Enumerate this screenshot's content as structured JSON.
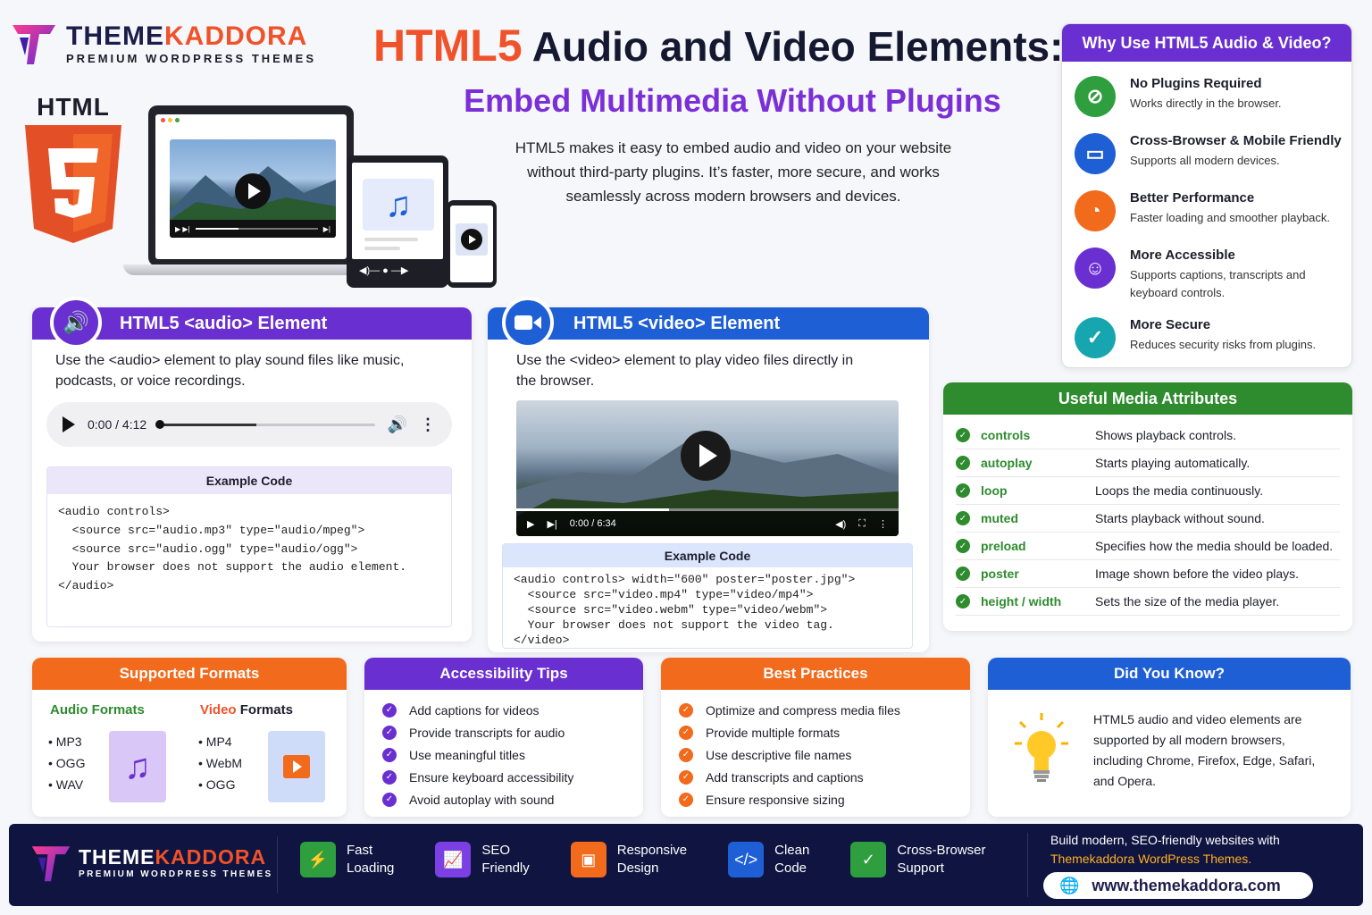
{
  "brand": {
    "name_part1": "THEME",
    "name_part2": "KADDORA",
    "subtitle": "PREMIUM WORDPRESS THEMES"
  },
  "html5_logo": {
    "label": "HTML",
    "number": "5"
  },
  "hero": {
    "title_accent": "HTML5",
    "title_rest": "Audio and Video Elements:",
    "subtitle": "Embed Multimedia Without Plugins",
    "description": "HTML5 makes it easy to embed audio and video on your website without third-party plugins. It’s faster, more secure, and works seamlessly across modern browsers and devices."
  },
  "why": {
    "title": "Why Use HTML5 Audio & Video?",
    "items": [
      {
        "title": "No Plugins Required",
        "desc": "Works directly in the browser.",
        "icon": "no-plugin-icon",
        "color": "#2e9e3e"
      },
      {
        "title": "Cross-Browser & Mobile Friendly",
        "desc": "Supports all modern devices.",
        "icon": "devices-icon",
        "color": "#1e5fd6"
      },
      {
        "title": "Better Performance",
        "desc": "Faster loading and smoother playback.",
        "icon": "speedometer-icon",
        "color": "#f26a1b"
      },
      {
        "title": "More Accessible",
        "desc": "Supports captions, transcripts and keyboard controls.",
        "icon": "accessibility-icon",
        "color": "#6a2fd0"
      },
      {
        "title": "More Secure",
        "desc": "Reduces security risks from plugins.",
        "icon": "shield-check-icon",
        "color": "#17a6b0"
      }
    ]
  },
  "audio": {
    "title": "HTML5 <audio> Element",
    "desc": "Use the <audio> element to play sound files like music, podcasts, or voice recordings.",
    "player_time": "0:00 / 4:12",
    "progress": 0.45,
    "code_title": "Example Code",
    "code": [
      "<audio controls>",
      "  <source src=\"audio.mp3\" type=\"audio/mpeg\">",
      "  <source src=\"audio.ogg\" type=\"audio/ogg\">",
      "  Your browser does not support the audio element.",
      "</audio>"
    ]
  },
  "video": {
    "title": "HTML5 <video> Element",
    "desc": "Use the <video> element to play video files directly in the browser.",
    "player_time": "0:00 / 6:34",
    "progress": 0.4,
    "code_title": "Example Code",
    "code": [
      "<audio controls> width=\"600\" poster=\"poster.jpg\">",
      "  <source src=\"video.mp4\" type=\"video/mp4\">",
      "  <source src=\"video.webm\" type=\"video/webm\">",
      "  Your browser does not support the video tag.",
      "</video>"
    ]
  },
  "attributes": {
    "title": "Useful Media Attributes",
    "rows": [
      {
        "name": "controls",
        "desc": "Shows playback controls."
      },
      {
        "name": "autoplay",
        "desc": "Starts playing automatically."
      },
      {
        "name": "loop",
        "desc": "Loops the media continuously."
      },
      {
        "name": "muted",
        "desc": "Starts playback without sound."
      },
      {
        "name": "preload",
        "desc": "Specifies how the media should be loaded."
      },
      {
        "name": "poster",
        "desc": "Image shown before the video plays."
      },
      {
        "name": "height / width",
        "desc": "Sets the size of the media player."
      }
    ]
  },
  "formats": {
    "title": "Supported Formats",
    "audio_title": "Audio Formats",
    "audio": [
      "MP3",
      "OGG",
      "WAV"
    ],
    "video_title_accent": "Video",
    "video_title_rest": "Formats",
    "video": [
      "MP4",
      "WebM",
      "OGG"
    ]
  },
  "accessibility": {
    "title": "Accessibility Tips",
    "items": [
      "Add captions for videos",
      "Provide transcripts for audio",
      "Use meaningful titles",
      "Ensure keyboard accessibility",
      "Avoid autoplay with sound"
    ]
  },
  "practices": {
    "title": "Best Practices",
    "items": [
      "Optimize and compress media files",
      "Provide multiple formats",
      "Use descriptive file names",
      "Add transcripts and captions",
      "Ensure responsive sizing"
    ]
  },
  "didyouknow": {
    "title": "Did You Know?",
    "text": "HTML5 audio and video elements are supported by all modern browsers, including Chrome, Firefox, Edge, Safari, and Opera."
  },
  "footer": {
    "features": [
      {
        "line1": "Fast",
        "line2": "Loading",
        "icon": "lightning-icon",
        "color": "#2e9e3e"
      },
      {
        "line1": "SEO",
        "line2": "Friendly",
        "icon": "chart-icon",
        "color": "#7b3fe4"
      },
      {
        "line1": "Responsive",
        "line2": "Design",
        "icon": "responsive-icon",
        "color": "#f26a1b"
      },
      {
        "line1": "Clean",
        "line2": "Code",
        "icon": "code-icon",
        "color": "#1e5fd6"
      },
      {
        "line1": "Cross-Browser",
        "line2": "Support",
        "icon": "shield-icon",
        "color": "#2e9e3e"
      }
    ],
    "cta_line1": "Build modern, SEO-friendly websites with",
    "cta_brand": "Themekaddora",
    "cta_rest": "WordPress Themes.",
    "url": "www.themekaddora.com"
  },
  "colors": {
    "purple": "#6a2fd0",
    "orange": "#f26a1b",
    "blue": "#1e5fd6",
    "green": "#2e8b2e",
    "navy": "#0f1540"
  }
}
